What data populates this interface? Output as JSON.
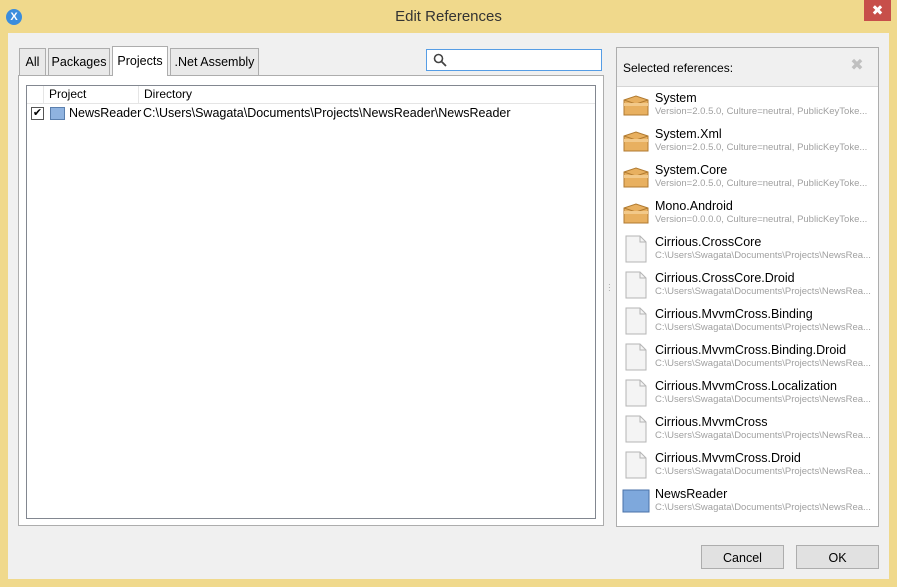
{
  "window": {
    "title": "Edit References",
    "app_icon": "xamarin-x-icon",
    "close_label": "✖"
  },
  "tabs": [
    {
      "label": "All",
      "active": false
    },
    {
      "label": "Packages",
      "active": false
    },
    {
      "label": "Projects",
      "active": true
    },
    {
      "label": ".Net Assembly",
      "active": false
    }
  ],
  "search": {
    "value": "",
    "placeholder": "",
    "icon": "search-icon"
  },
  "projects_table": {
    "columns": [
      "Project",
      "Directory"
    ],
    "rows": [
      {
        "checked": true,
        "project": "NewsReader",
        "directory": "C:\\Users\\Swagata\\Documents\\Projects\\NewsReader\\NewsReader"
      }
    ]
  },
  "selected_references": {
    "title": "Selected references:",
    "remove_icon": "remove-x-icon",
    "items": [
      {
        "name": "System",
        "detail": "Version=2.0.5.0, Culture=neutral, PublicKeyToke...",
        "icon": "package-icon"
      },
      {
        "name": "System.Xml",
        "detail": "Version=2.0.5.0, Culture=neutral, PublicKeyToke...",
        "icon": "package-icon"
      },
      {
        "name": "System.Core",
        "detail": "Version=2.0.5.0, Culture=neutral, PublicKeyToke...",
        "icon": "package-icon"
      },
      {
        "name": "Mono.Android",
        "detail": "Version=0.0.0.0, Culture=neutral, PublicKeyToke...",
        "icon": "package-icon"
      },
      {
        "name": "Cirrious.CrossCore",
        "detail": "C:\\Users\\Swagata\\Documents\\Projects\\NewsRea...",
        "icon": "file-icon"
      },
      {
        "name": "Cirrious.CrossCore.Droid",
        "detail": "C:\\Users\\Swagata\\Documents\\Projects\\NewsRea...",
        "icon": "file-icon"
      },
      {
        "name": "Cirrious.MvvmCross.Binding",
        "detail": "C:\\Users\\Swagata\\Documents\\Projects\\NewsRea...",
        "icon": "file-icon"
      },
      {
        "name": "Cirrious.MvvmCross.Binding.Droid",
        "detail": "C:\\Users\\Swagata\\Documents\\Projects\\NewsRea...",
        "icon": "file-icon"
      },
      {
        "name": "Cirrious.MvvmCross.Localization",
        "detail": "C:\\Users\\Swagata\\Documents\\Projects\\NewsRea...",
        "icon": "file-icon"
      },
      {
        "name": "Cirrious.MvvmCross",
        "detail": "C:\\Users\\Swagata\\Documents\\Projects\\NewsRea...",
        "icon": "file-icon"
      },
      {
        "name": "Cirrious.MvvmCross.Droid",
        "detail": "C:\\Users\\Swagata\\Documents\\Projects\\NewsRea...",
        "icon": "file-icon"
      },
      {
        "name": "NewsReader",
        "detail": "C:\\Users\\Swagata\\Documents\\Projects\\NewsRea...",
        "icon": "project-icon"
      }
    ]
  },
  "buttons": {
    "cancel": "Cancel",
    "ok": "OK"
  }
}
